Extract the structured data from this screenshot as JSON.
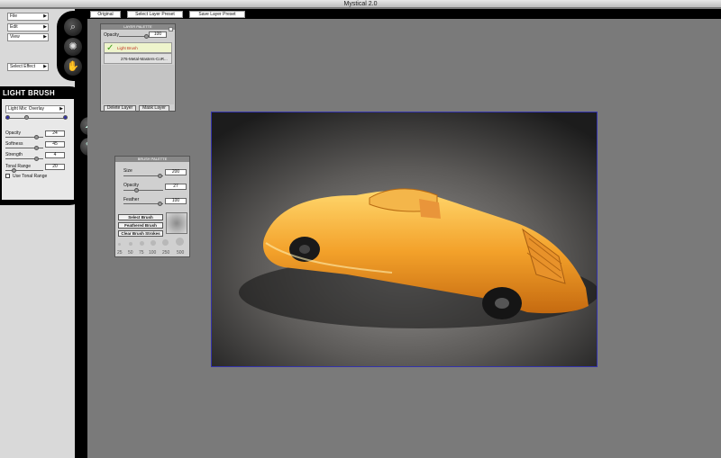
{
  "window": {
    "title": "Mystical 2.0"
  },
  "menus": [
    {
      "label": "File"
    },
    {
      "label": "Edit"
    },
    {
      "label": "View"
    },
    {
      "label": "Select Effect"
    }
  ],
  "tools": {
    "zoom": "magnifier-icon",
    "brush": "brush-dots-icon",
    "hand": "hand-icon"
  },
  "light_brush": {
    "title": "LIGHT BRUSH",
    "mix_mode": "Light Mix: Overlay",
    "opacity": {
      "label": "Opacity",
      "value": "24"
    },
    "softness": {
      "label": "Softness",
      "value": "45"
    },
    "strength": {
      "label": "Strength",
      "value": "4"
    },
    "tonal_range": {
      "label": "Tonal Range",
      "value": "20"
    },
    "use_tonal_range": "Use Tonal Range"
  },
  "tabs": [
    "Original",
    "Select Layer Preset",
    "Save Layer Preset"
  ],
  "layer_palette": {
    "title": "LAYER PALETTE",
    "opacity_label": "Opacity",
    "opacity_value": "100",
    "layers": [
      "Light Brush",
      "276-Metal-Masters-CoR..."
    ],
    "delete_label": "Delete Layer",
    "mask_label": "Mask Layer"
  },
  "brush_palette": {
    "title": "BRUSH PALETTE",
    "size": {
      "label": "Size",
      "value": "200"
    },
    "opacity": {
      "label": "Opacity",
      "value": "27"
    },
    "feather": {
      "label": "Feather",
      "value": "100"
    },
    "select_label": "Select Brush",
    "feathered_label": "Feathered Brush",
    "clear_label": "Clear Brush Strokes",
    "sizes": [
      "25",
      "50",
      "75",
      "100",
      "250",
      "500"
    ]
  },
  "colors": {
    "accent_check": "#3a9a1a",
    "layer_active_text": "#c03020",
    "canvas_border": "#3333aa"
  }
}
